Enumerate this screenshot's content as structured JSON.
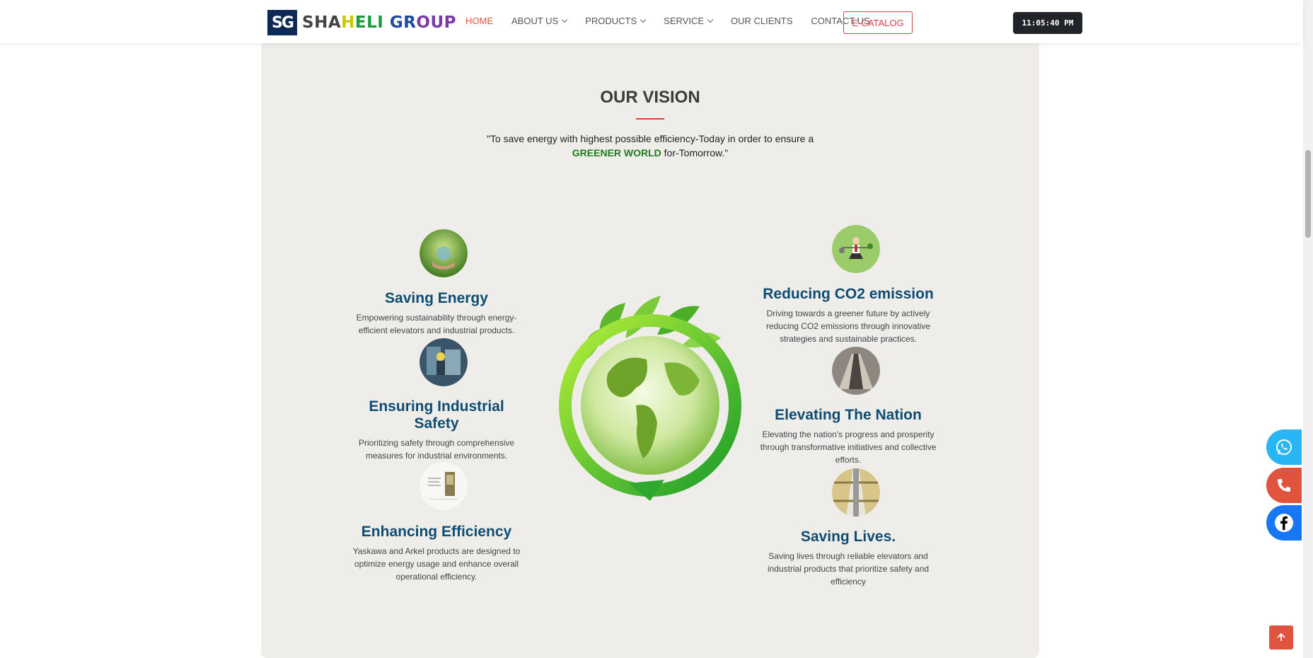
{
  "header": {
    "logo_letters": "SG",
    "logo_parts": [
      "SHA",
      "H",
      "ELI ",
      "GR",
      "OUP"
    ],
    "nav": [
      {
        "label": "HOME",
        "dropdown": false,
        "active": true
      },
      {
        "label": "ABOUT US",
        "dropdown": true,
        "active": false
      },
      {
        "label": "PRODUCTS",
        "dropdown": true,
        "active": false
      },
      {
        "label": "SERVICE",
        "dropdown": true,
        "active": false
      },
      {
        "label": "OUR CLIENTS",
        "dropdown": false,
        "active": false
      },
      {
        "label": "CONTACT US",
        "dropdown": false,
        "active": false
      }
    ],
    "ecatalog_label": "E-CATALOG",
    "clock": "11:05:40 PM"
  },
  "vision": {
    "title": "OUR VISION",
    "quote_before": "\"To save energy with highest possible efficiency-Today in order to ensure a",
    "quote_highlight": "GREENER WORLD",
    "quote_after": "for-Tomorrow.\""
  },
  "features_left": [
    {
      "title": "Saving Energy",
      "desc": "Empowering sustainability through energy-efficient elevators and industrial products.",
      "icon": "hands-plant-icon"
    },
    {
      "title": "Ensuring Industrial Safety",
      "desc": "Prioritizing safety through comprehensive measures for industrial environments.",
      "icon": "factory-worker-icon"
    },
    {
      "title": "Enhancing Efficiency",
      "desc": "Yaskawa and Arkel products are designed to optimize energy usage and enhance overall operational efficiency.",
      "icon": "inverter-device-icon"
    }
  ],
  "features_right": [
    {
      "title": "Reducing CO2 emission",
      "desc": "Driving towards a greener future by actively reducing CO2 emissions through innovative strategies and sustainable practices.",
      "icon": "businessman-balance-icon"
    },
    {
      "title": "Elevating The Nation",
      "desc": "Elevating the nation's progress and prosperity through transformative initiatives and collective efforts.",
      "icon": "escalator-icon"
    },
    {
      "title": "Saving Lives.",
      "desc": "Saving lives through reliable elevators and industrial products that prioritize safety and efficiency",
      "icon": "elevator-shaft-icon"
    }
  ],
  "colors": {
    "accent": "#e0533d",
    "title_blue": "#0f4c72",
    "green": "#1f7d1f",
    "panel_bg": "#efede9",
    "whatsapp": "#25d366",
    "phone": "#e0533d",
    "facebook": "#1877f2"
  },
  "floating": [
    "whatsapp-icon",
    "phone-icon",
    "facebook-icon"
  ]
}
